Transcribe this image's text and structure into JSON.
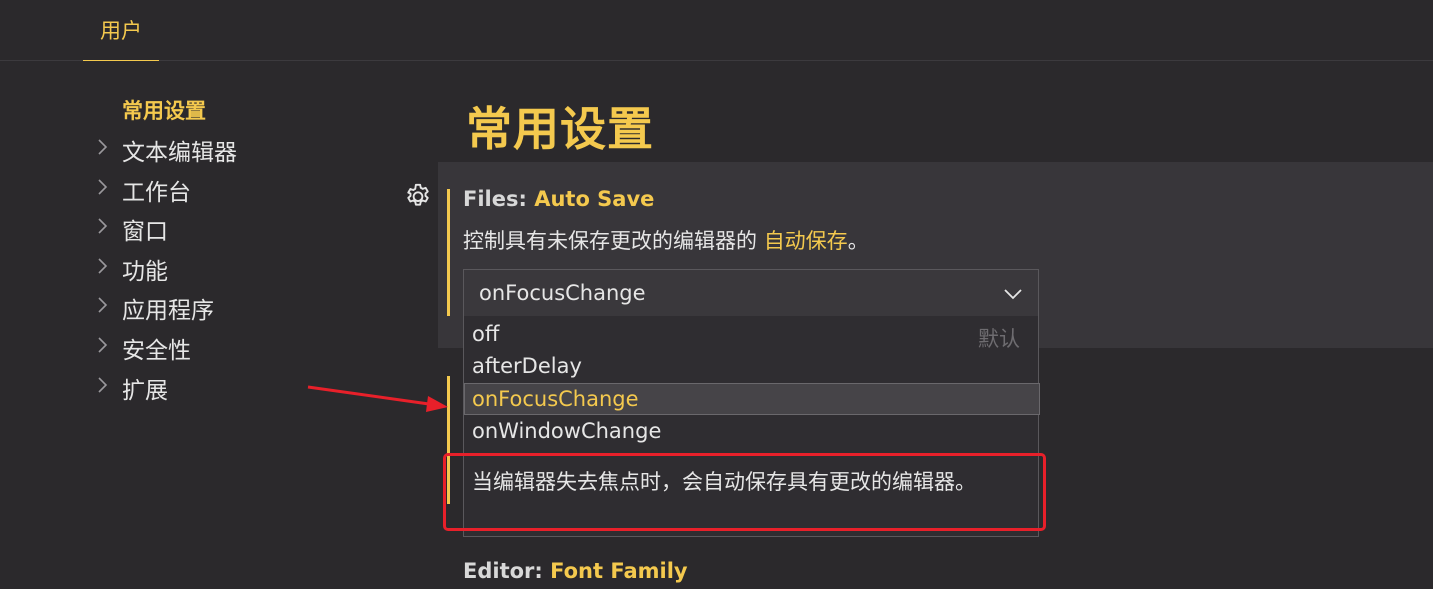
{
  "tabs": {
    "user": "用户"
  },
  "sidebar": {
    "items": [
      {
        "label": "常用设置",
        "active": true
      },
      {
        "label": "文本编辑器"
      },
      {
        "label": "工作台"
      },
      {
        "label": "窗口"
      },
      {
        "label": "功能"
      },
      {
        "label": "应用程序"
      },
      {
        "label": "安全性"
      },
      {
        "label": "扩展"
      }
    ]
  },
  "main": {
    "title": "常用设置",
    "auto_save": {
      "category": "Files: ",
      "key": "Auto Save",
      "desc_prefix": "控制具有未保存更改的编辑器的 ",
      "desc_link": "自动保存",
      "desc_suffix": "。",
      "selected": "onFocusChange",
      "options": [
        {
          "label": "off",
          "default_label": "默认"
        },
        {
          "label": "afterDelay"
        },
        {
          "label": "onFocusChange"
        },
        {
          "label": "onWindowChange"
        }
      ],
      "option_description": "当编辑器失去焦点时，会自动保存具有更改的编辑器。"
    },
    "next_setting": {
      "category": "Editor: ",
      "key": "Font Family"
    }
  },
  "colors": {
    "accent": "#f4c94e",
    "background": "#2b292c",
    "panel": "#38363a",
    "annotation": "#e8202a"
  },
  "icons": {
    "gear": "gear-icon",
    "chevron": "chevron-right-icon",
    "caret": "chevron-down-icon"
  }
}
